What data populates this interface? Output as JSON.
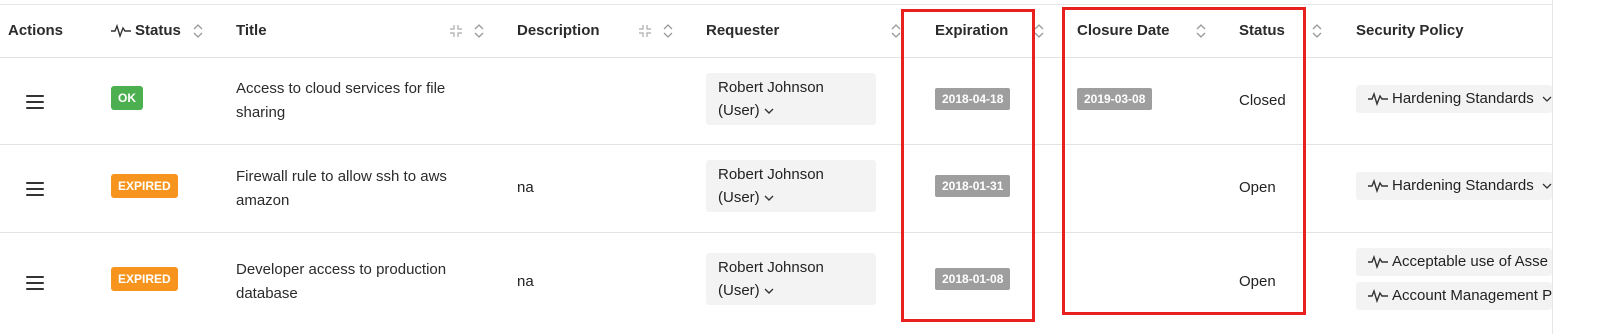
{
  "columns": {
    "actions": "Actions",
    "status": "Status",
    "title": "Title",
    "description": "Description",
    "requester": "Requester",
    "expiration": "Expiration",
    "closure_date": "Closure Date",
    "status2": "Status",
    "security_policy": "Security Policy"
  },
  "rows": [
    {
      "status_badge": "OK",
      "title": "Access to cloud services for file sharing",
      "description": "",
      "requester_name": "Robert Johnson",
      "requester_type": "(User)",
      "expiration": "2018-04-18",
      "closure_date": "2019-03-08",
      "status": "Closed",
      "policies": [
        "Hardening Standards"
      ]
    },
    {
      "status_badge": "EXPIRED",
      "title": "Firewall rule to allow ssh to aws amazon",
      "description": "na",
      "requester_name": "Robert Johnson",
      "requester_type": "(User)",
      "expiration": "2018-01-31",
      "closure_date": "",
      "status": "Open",
      "policies": [
        "Hardening Standards"
      ]
    },
    {
      "status_badge": "EXPIRED",
      "title": "Developer access to production database",
      "description": "na",
      "requester_name": "Robert Johnson",
      "requester_type": "(User)",
      "expiration": "2018-01-08",
      "closure_date": "",
      "status": "Open",
      "policies": [
        "Acceptable use of Asse",
        "Account Management P"
      ]
    }
  ],
  "colors": {
    "ok_badge": "#4caf50",
    "expired_badge": "#f7941d",
    "date_badge": "#9e9e9e",
    "highlight": "#e8211f"
  }
}
